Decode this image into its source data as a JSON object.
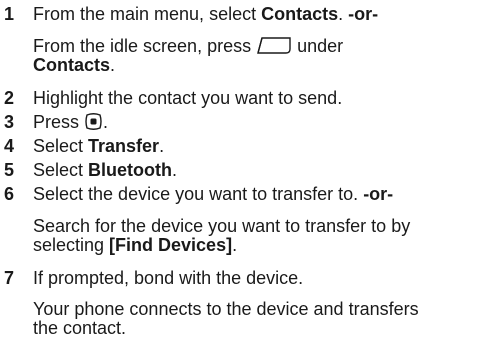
{
  "steps": [
    {
      "num": "1",
      "pre": "From the main menu, select ",
      "bold": "Contacts",
      "post": ". ",
      "or": "-or-"
    },
    {
      "alt": {
        "pre": "From the idle screen, press ",
        "icon": "softkey-icon",
        "mid": " under",
        "bold": "Contacts",
        "post": "."
      }
    },
    {
      "num": "2",
      "text": "Highlight the contact you want to send."
    },
    {
      "num": "3",
      "pre": "Press ",
      "icon": "center-select-key-icon",
      "post": "."
    },
    {
      "num": "4",
      "pre": "Select ",
      "bold": "Transfer",
      "post": "."
    },
    {
      "num": "5",
      "pre": "Select ",
      "bold": "Bluetooth",
      "post": "."
    },
    {
      "num": "6",
      "text": "Select the device you want to transfer to. ",
      "or": "-or-"
    },
    {
      "alt": {
        "line1": "Search for the device you want to transfer to by",
        "pre": "selecting ",
        "bold": "[Find Devices]",
        "post": "."
      }
    },
    {
      "num": "7",
      "text": "If prompted, bond with the device."
    },
    {
      "result": {
        "line1": "Your phone connects to the device and transfers",
        "line2": "the contact."
      }
    }
  ],
  "colors": {
    "text": "#1a1a1a",
    "background": "#ffffff"
  }
}
